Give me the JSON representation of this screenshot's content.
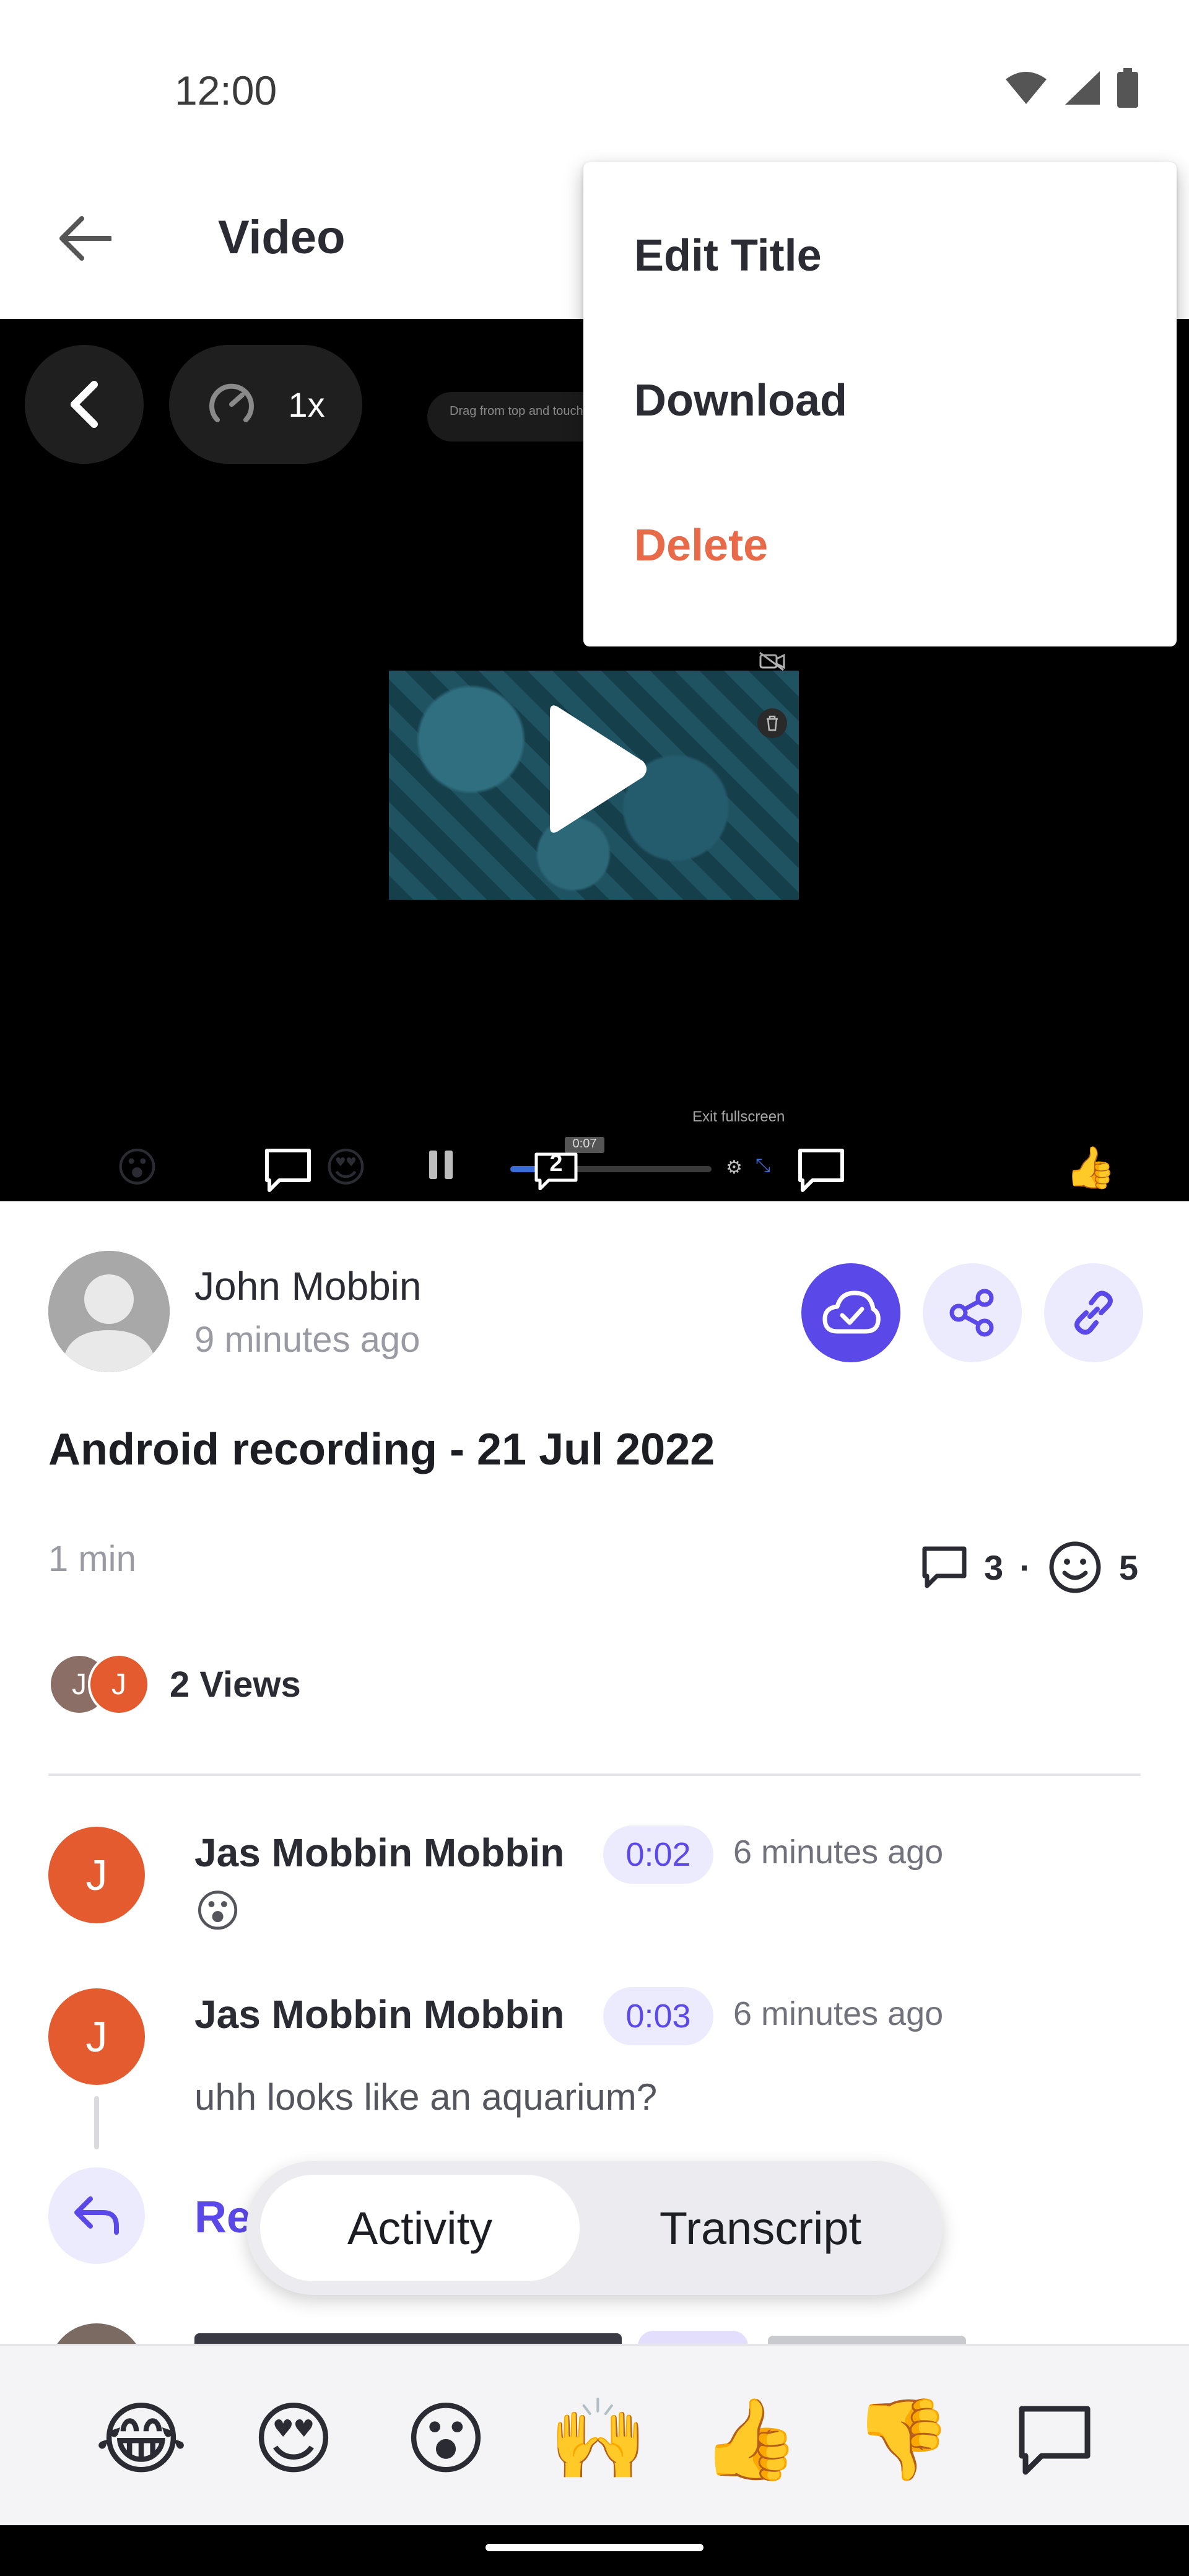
{
  "status_bar": {
    "time": "12:00",
    "icons": [
      "wifi-icon",
      "signal-icon",
      "battery-icon"
    ]
  },
  "app_bar": {
    "title": "Video"
  },
  "overflow_menu": {
    "items": [
      "Edit Title",
      "Download",
      "Delete"
    ],
    "danger_color": "#E86A48"
  },
  "player": {
    "speed": "1x",
    "hint_text": "Drag from top and touch",
    "exit_fullscreen": "Exit fullscreen",
    "mini_time": "0:07",
    "timeline_comment_count": "2"
  },
  "owner": {
    "name": "John Mobbin",
    "time_ago": "9 minutes ago"
  },
  "video": {
    "title": "Android recording - 21 Jul 2022",
    "duration": "1 min",
    "comment_count": "3",
    "separator": "·",
    "reaction_count": "5",
    "views_label": "2 Views",
    "viewer_initials": [
      "J",
      "J"
    ]
  },
  "comments": [
    {
      "initial": "J",
      "name": "Jas Mobbin Mobbin",
      "timestamp": "0:02",
      "ago": "6 minutes ago",
      "body": "😮"
    },
    {
      "initial": "J",
      "name": "Jas Mobbin Mobbin",
      "timestamp": "0:03",
      "ago": "6 minutes ago",
      "body": "uhh looks like an aquarium?"
    }
  ],
  "reply": {
    "label": "Re"
  },
  "tabs": [
    {
      "label": "Activity",
      "active": true
    },
    {
      "label": "Transcript",
      "active": false
    }
  ],
  "reactions": [
    "😂",
    "😍",
    "😮",
    "🙌",
    "👍",
    "👎"
  ],
  "colors": {
    "accent": "#5B48E8",
    "accent_light": "#ECEAFD",
    "avatar_orange": "#E35B2F"
  }
}
